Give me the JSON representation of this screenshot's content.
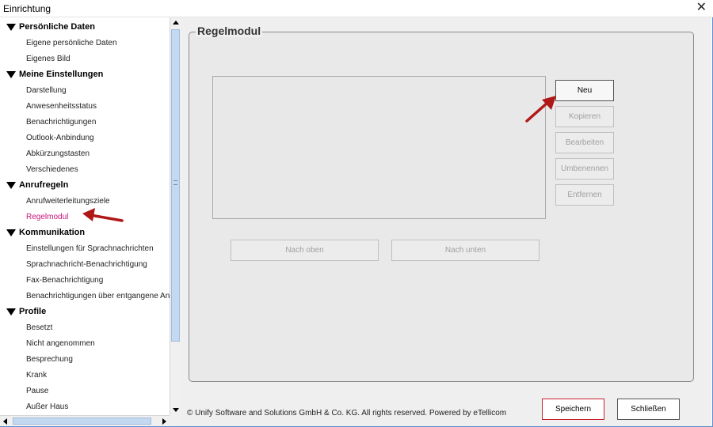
{
  "window": {
    "title": "Einrichtung",
    "close_glyph": "✕"
  },
  "tree": {
    "sections": [
      {
        "label": "Persönliche Daten",
        "items": [
          {
            "label": "Eigene persönliche Daten"
          },
          {
            "label": "Eigenes Bild"
          }
        ]
      },
      {
        "label": "Meine Einstellungen",
        "items": [
          {
            "label": "Darstellung"
          },
          {
            "label": "Anwesenheitsstatus"
          },
          {
            "label": "Benachrichtigungen"
          },
          {
            "label": "Outlook-Anbindung"
          },
          {
            "label": "Abkürzungstasten"
          },
          {
            "label": "Verschiedenes"
          }
        ]
      },
      {
        "label": "Anrufregeln",
        "items": [
          {
            "label": "Anrufweiterleitungsziele"
          },
          {
            "label": "Regelmodul",
            "selected": true
          }
        ]
      },
      {
        "label": "Kommunikation",
        "items": [
          {
            "label": "Einstellungen für Sprachnachrichten"
          },
          {
            "label": "Sprachnachricht-Benachrichtigung"
          },
          {
            "label": "Fax-Benachrichtigung"
          },
          {
            "label": "Benachrichtigungen über entgangene Anrufe"
          }
        ]
      },
      {
        "label": "Profile",
        "items": [
          {
            "label": "Besetzt"
          },
          {
            "label": "Nicht angenommen"
          },
          {
            "label": "Besprechung"
          },
          {
            "label": "Krank"
          },
          {
            "label": "Pause"
          },
          {
            "label": "Außer Haus"
          }
        ]
      }
    ]
  },
  "panel": {
    "title": "Regelmodul",
    "buttons": {
      "new": "Neu",
      "copy": "Kopieren",
      "edit": "Bearbeiten",
      "rename": "Umbenennen",
      "remove": "Entfernen",
      "move_up": "Nach oben",
      "move_down": "Nach unten"
    }
  },
  "footer": {
    "copyright": "© Unify Software and Solutions GmbH & Co. KG. All rights reserved. Powered by eTellicom",
    "save": "Speichern",
    "close": "Schließen"
  },
  "colors": {
    "selected_item": "#c8137a",
    "annotation_arrow": "#b01818",
    "save_border": "#c8202f",
    "scroll_thumb": "#c4d8f0"
  }
}
